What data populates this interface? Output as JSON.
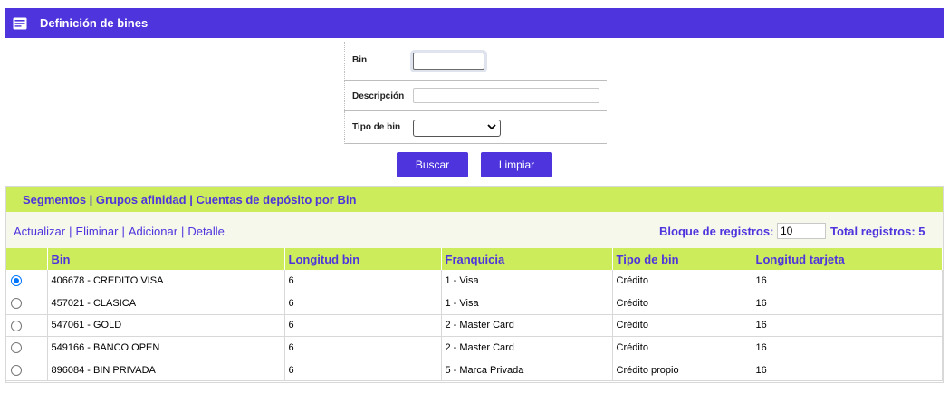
{
  "header": {
    "title": "Definición de bines",
    "icon": "card-icon"
  },
  "form": {
    "bin_label": "Bin",
    "bin_value": "",
    "descripcion_label": "Descripción",
    "descripcion_value": "",
    "tipo_label": "Tipo de bin",
    "tipo_value": ""
  },
  "buttons": {
    "buscar": "Buscar",
    "limpiar": "Limpiar"
  },
  "links": "Segmentos | Grupos afinidad | Cuentas de depósito por Bin",
  "actions": {
    "actualizar": "Actualizar",
    "eliminar": "Eliminar",
    "adicionar": "Adicionar",
    "detalle": "Detalle",
    "separator": "|"
  },
  "paging": {
    "bloque_label": "Bloque de registros:",
    "bloque_value": "10",
    "total_label": "Total registros: 5"
  },
  "table": {
    "columns": [
      "Bin",
      "Longitud bin",
      "Franquicia",
      "Tipo de bin",
      "Longitud tarjeta"
    ],
    "rows": [
      {
        "selected": true,
        "bin": "406678 - CREDITO VISA",
        "longitud": "6",
        "franquicia": "1 - Visa",
        "tipo": "Crédito",
        "longitud_tarjeta": "16"
      },
      {
        "selected": false,
        "bin": "457021 - CLASICA",
        "longitud": "6",
        "franquicia": "1 - Visa",
        "tipo": "Crédito",
        "longitud_tarjeta": "16"
      },
      {
        "selected": false,
        "bin": "547061 - GOLD",
        "longitud": "6",
        "franquicia": "2 - Master Card",
        "tipo": "Crédito",
        "longitud_tarjeta": "16"
      },
      {
        "selected": false,
        "bin": "549166 - BANCO OPEN",
        "longitud": "6",
        "franquicia": "2 - Master Card",
        "tipo": "Crédito",
        "longitud_tarjeta": "16"
      },
      {
        "selected": false,
        "bin": "896084 - BIN PRIVADA",
        "longitud": "6",
        "franquicia": "5 - Marca Privada",
        "tipo": "Crédito propio",
        "longitud_tarjeta": "16"
      }
    ]
  },
  "colors": {
    "primary": "#4e34dd",
    "accent": "#cdec5b",
    "selected_radio": "#0075ff"
  }
}
